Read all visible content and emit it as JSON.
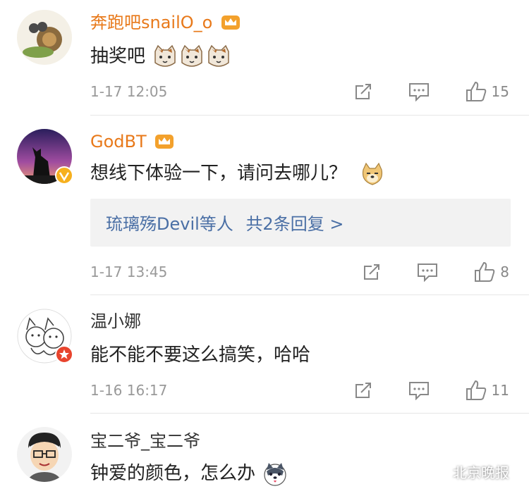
{
  "comments": [
    {
      "username": "奔跑吧snailO_o",
      "text": "抽奖吧",
      "time": "1-17 12:05",
      "likes": "15",
      "emojis": [
        "cat-face-icon",
        "cat-face-icon",
        "cat-face-icon"
      ]
    },
    {
      "username": "GodBT",
      "text": "想线下体验一下，请问去哪儿？",
      "time": "1-17 13:45",
      "likes": "8",
      "emojis": [
        "doge-icon"
      ],
      "replies": {
        "names": "琉璃殇Devil等人",
        "more": "共2条回复 >"
      }
    },
    {
      "username": "温小娜",
      "text": "能不能不要这么搞笑，哈哈",
      "time": "1-16 16:17",
      "likes": "11",
      "emojis": []
    },
    {
      "username": "宝二爷_宝二爷",
      "text": "钟爱的颜色，怎么办",
      "emojis": [
        "husky-face-icon"
      ]
    }
  ],
  "watermark": {
    "text": "北京晚报"
  },
  "colors": {
    "vip_name": "#e8791a",
    "reply_link": "#4a6fa5",
    "crown": "#f3a12c"
  }
}
